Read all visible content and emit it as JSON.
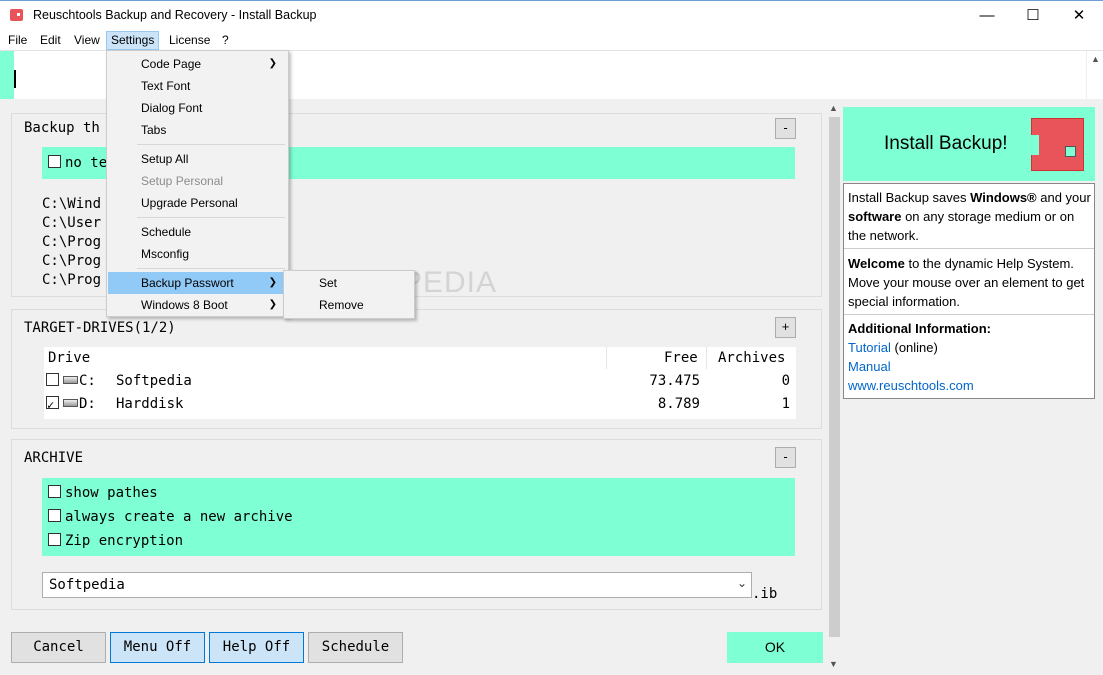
{
  "window": {
    "title": "Reuschtools Backup and Recovery - Install Backup",
    "minimize": "—",
    "maximize": "☐",
    "close": "✕"
  },
  "menubar": [
    "File",
    "Edit",
    "View",
    "Settings",
    "License",
    "?"
  ],
  "settings_menu": {
    "items": [
      {
        "label": "Code Page",
        "submenu": true
      },
      {
        "label": "Text Font"
      },
      {
        "label": "Dialog Font"
      },
      {
        "label": "Tabs"
      },
      {
        "label": "Setup All"
      },
      {
        "label": "Setup Personal",
        "disabled": true
      },
      {
        "label": "Upgrade Personal"
      },
      {
        "label": "Schedule"
      },
      {
        "label": "Msconfig"
      },
      {
        "label": "Backup Passwort",
        "submenu": true,
        "highlighted": true
      },
      {
        "label": "Windows 8 Boot",
        "submenu": true
      }
    ],
    "submenu_backup_passwort": [
      "Set",
      "Remove"
    ]
  },
  "backup_group": {
    "title": "Backup th",
    "collapse_label": "-",
    "checkbox_label": "no te",
    "paths": [
      "C:\\Wind",
      "C:\\User",
      "C:\\Prog",
      "C:\\Prog",
      "C:\\Prog"
    ]
  },
  "target_drives": {
    "title": "TARGET-DRIVES(1/2)",
    "expand_label": "+",
    "columns": [
      "Drive",
      "Free",
      "Archives"
    ],
    "rows": [
      {
        "checked": false,
        "letter": "C:",
        "name": "Softpedia",
        "free": "73.475",
        "archives": "0"
      },
      {
        "checked": true,
        "letter": "D:",
        "name": "Harddisk",
        "free": "8.789",
        "archives": "1"
      }
    ]
  },
  "archive": {
    "title": "ARCHIVE",
    "collapse_label": "-",
    "options": [
      "show pathes",
      "always create a new archive",
      "Zip encryption"
    ],
    "name_value": "Softpedia",
    "extension": ".ib"
  },
  "buttons": {
    "cancel": "Cancel",
    "menu_off": "Menu Off",
    "help_off": "Help Off",
    "schedule": "Schedule",
    "ok": "OK"
  },
  "help": {
    "title": "Install Backup!",
    "sec1": {
      "t1": "Install Backup saves ",
      "b1": "Windows®",
      "t2": " and your ",
      "b2": "software",
      "t3": " on any storage medium or on the network."
    },
    "sec2": {
      "b1": "Welcome",
      "t1": " to the dynamic Help System. Move your mouse over an element to get special information."
    },
    "sec3": {
      "heading": "Additional Information:",
      "link1": "Tutorial",
      "link1_suffix": " (online)",
      "link2": "Manual",
      "link3": "www.reuschtools.com"
    }
  },
  "watermark": "SOFTPEDIA",
  "colors": {
    "accent_green": "#7fffd4",
    "logo_red": "#e8545a",
    "menu_highlight": "#91c9f7"
  }
}
